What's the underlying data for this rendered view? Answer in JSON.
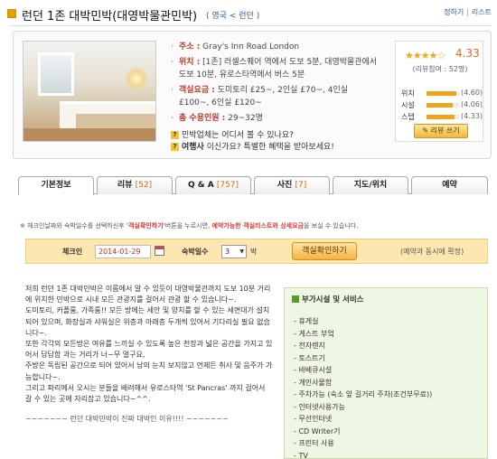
{
  "header": {
    "title": "런던 1존 대박민박(대영박물관민박)",
    "crumb_open": "(",
    "crumb_country": "영국",
    "crumb_sep": "<",
    "crumb_city": "런던",
    "crumb_close": ")",
    "link_inquiry": "정하기",
    "link_list": "리스트",
    "link_sep": "|"
  },
  "info": {
    "address_label": "주소 :",
    "address_value": "Gray's Inn Road London",
    "location_label": "위치 :",
    "location_value": "[1존] 러셀스퀘어 역에서 도보 5분, 대영박물관에서 도보 10분, 유로스타역에서 버스 5분",
    "price_label": "객실요금 :",
    "price_value": "도미토리 £25~, 2인실 £70~, 4인실 £100~, 6인실 £120~",
    "capacity_label": "총 수용인원 :",
    "capacity_value": "29~32명",
    "q1_text": "민박업체는 어디서 볼 수 있나요?",
    "q2_bold": "여행사",
    "q2_text": " 이신가요? 특별한 혜택을 받아보세요!"
  },
  "rating": {
    "stars": "★★★★☆",
    "score": "4.33",
    "count_text": "(리뷰참여 : 52명)",
    "rows": [
      {
        "label": "위치",
        "value": "(4.60)",
        "fraction": 0.92
      },
      {
        "label": "시설",
        "value": "(4.06)",
        "fraction": 0.81
      },
      {
        "label": "스텝",
        "value": "(4.33)",
        "fraction": 0.87
      }
    ],
    "review_button": "리뷰 쓰기"
  },
  "tabs": [
    {
      "label": "기본정보",
      "count": ""
    },
    {
      "label": "리뷰 ",
      "count": "[52]"
    },
    {
      "label": "Q & A ",
      "count": "[757]"
    },
    {
      "label": "사진 ",
      "count": "[7]"
    },
    {
      "label": "지도/위치",
      "count": ""
    },
    {
      "label": "예약",
      "count": ""
    }
  ],
  "notice": {
    "pre": "※ 체크인날짜와 숙박일수를 선택하신후 ",
    "hl1": "'객실확인하기'",
    "mid": "버튼을 누르시면, ",
    "hl2": "예약가능한 객실리스트와 상세요금",
    "post": "을 보실 수 있습니다."
  },
  "search": {
    "checkin_label": "체크인",
    "checkin_date": "2014-01-29",
    "nights_label": "숙박일수",
    "nights_value": "3",
    "nights_unit": "박",
    "check_button": "객실확인하기",
    "note": "(예약과 동시에 확정)"
  },
  "description": [
    "저희 런던 1존 대박민박은 이름에서 알 수 있듯이 대영박물관까지 도보 10분 거리에 위치한 민박으로 시내 모든 관광지를 걸어서 관광 할 수 있습니다~.",
    "도미토리, 커플룸, 가족룸!! 모든 방에는 세안 및 양치를 할 수 있는 세면대가 설치되어 있으며, 화장실과 샤워실은 위층과 아래층 두개씩 있어서 기다리실 필요 없습니다~.",
    "또한 각각의 모든방은 여유를 느끼실 수 있도록 높은 천장과 넓은 공간을 가지고 있어서 답답함 과는 거리가 너~무 멀구요,",
    "주방은 독립된 공간으로 되어 있어서 남의 눈치 보지않고 언제든 취사 및 음주가 가능합니다~.",
    "그리고 파리에서 오시는 분들을 배려해서 유로스타역 'St Pancras' 까지 걸어서 갈 수 있는 곳에 자리잡고 있습니다~^^."
  ],
  "description_footer": "~~~~~~~ 런던 대박민박이 진짜 대박인 이유!!!! ~~~~~~~",
  "facilities": {
    "title": "부가시설 및 서비스",
    "items": [
      "휴게실",
      "게스트 부엌",
      "전자렌지",
      "토스트기",
      "바베큐시설",
      "개인사물함",
      "주차가능 (숙소 앞 길거리 주차(조건부무료))",
      "인터넷사용가능",
      "무선인터넷",
      "CD Writer기",
      "프린터 사용",
      "TV"
    ]
  },
  "colors": {
    "accent_red": "#c0392b",
    "orange": "#e36a12",
    "bar_bg": "#fde7b0",
    "green_box": "#f0f6e4"
  }
}
